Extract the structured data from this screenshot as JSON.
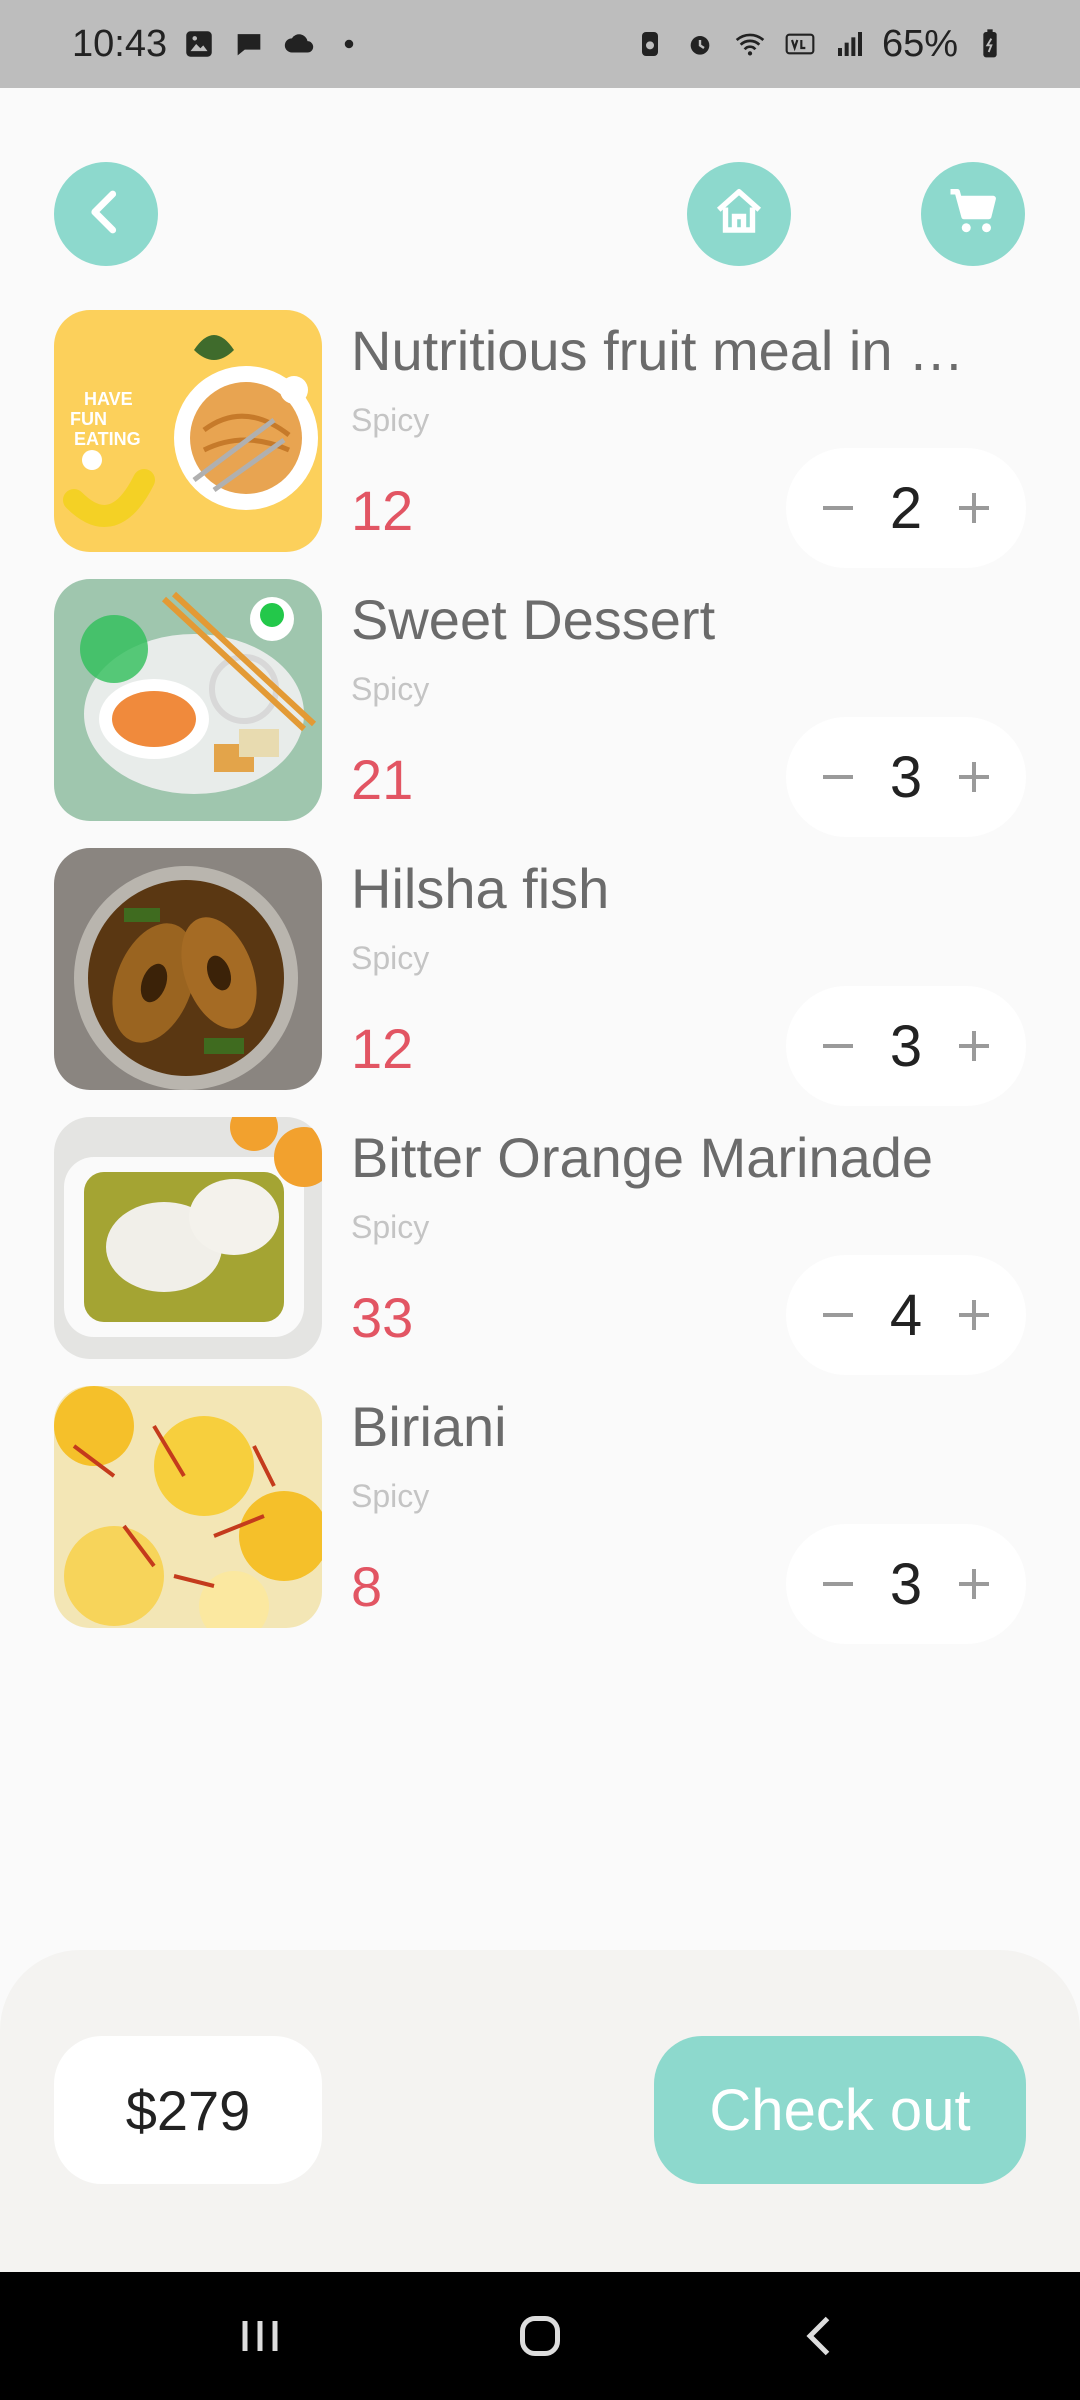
{
  "status_bar": {
    "time": "10:43",
    "battery": "65%",
    "icons": [
      "gallery-icon",
      "chat-icon",
      "cloud-icon",
      "dot-icon",
      "battery-saver-icon",
      "alarm-icon",
      "wifi-icon",
      "volte-icon",
      "signal-icon",
      "battery-icon"
    ]
  },
  "header": {
    "back_icon": "chevron-left-icon",
    "home_icon": "home-icon",
    "cart_icon": "cart-icon"
  },
  "items": [
    {
      "name": "Nutritious fruit meal in …",
      "tag": "Spicy",
      "price": "12",
      "qty": "2",
      "image": "pasta-plate"
    },
    {
      "name": "Sweet Dessert",
      "tag": "Spicy",
      "price": "21",
      "qty": "3",
      "image": "dessert-plate"
    },
    {
      "name": "Hilsha fish",
      "tag": "Spicy",
      "price": "12",
      "qty": "3",
      "image": "fish-curry"
    },
    {
      "name": "Bitter Orange Marinade",
      "tag": "Spicy",
      "price": "33",
      "qty": "4",
      "image": "chicken-marinade"
    },
    {
      "name": "Biriani",
      "tag": "Spicy",
      "price": "8",
      "qty": "3",
      "image": "saffron-rice"
    }
  ],
  "footer": {
    "total": "$279",
    "checkout_label": "Check out"
  },
  "colors": {
    "accent": "#8dd9cd",
    "price": "#e25563",
    "background": "#fafafa"
  }
}
